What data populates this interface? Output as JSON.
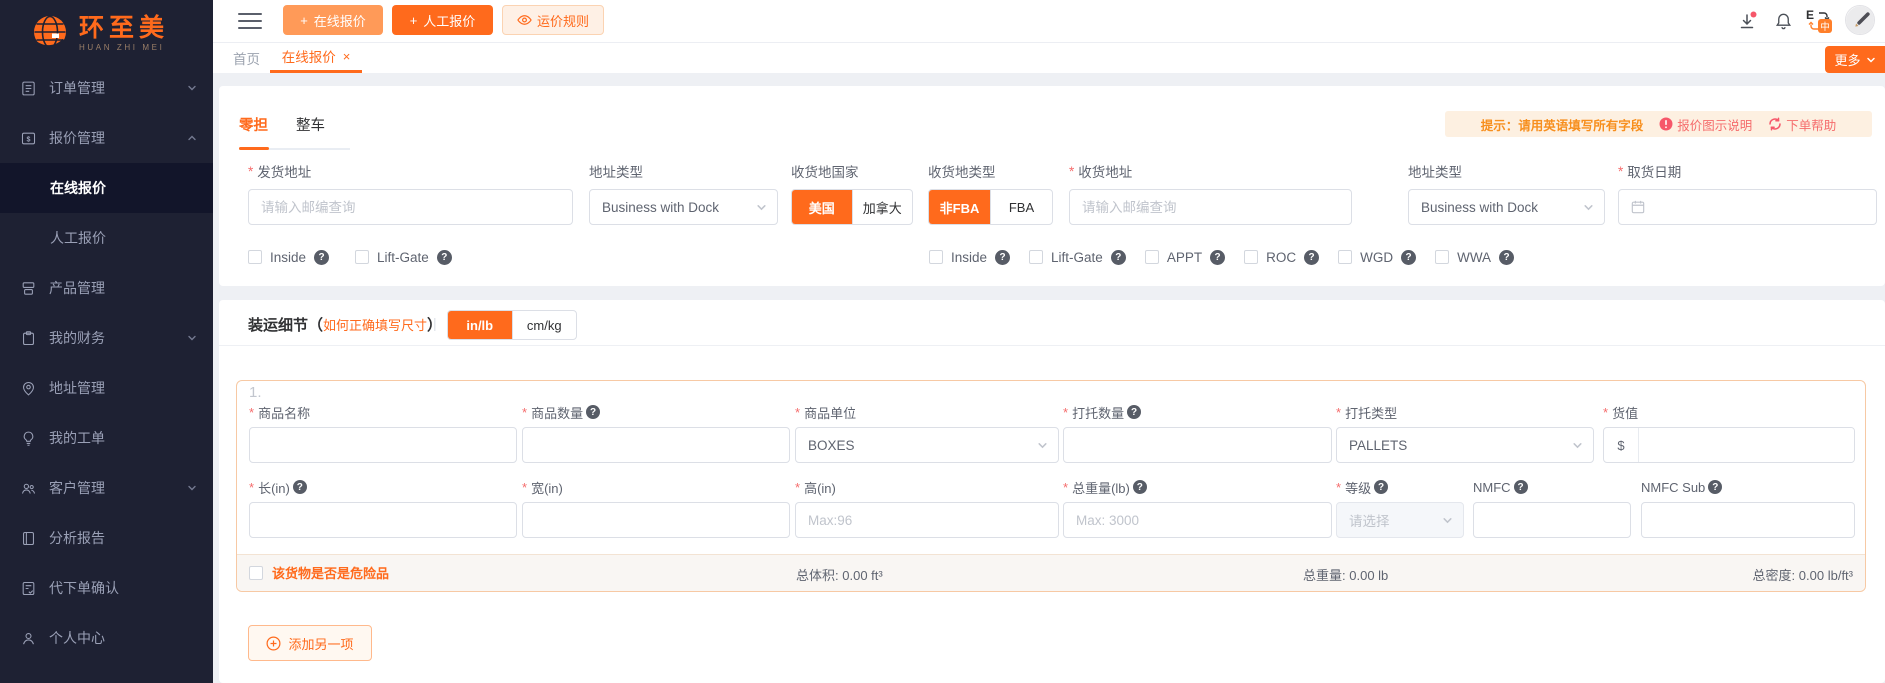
{
  "icons": {
    "plus": "+",
    "close": "×",
    "required": "*",
    "question": "?",
    "dollar": "$",
    "paren_open": "（",
    "paren_close": "）",
    "divider": "|",
    "index_1": "1."
  },
  "sidebar": {
    "logo_title": "环至美",
    "logo_subtitle": "HUAN ZHI MEI",
    "items": [
      {
        "label": "订单管理"
      },
      {
        "label": "报价管理"
      },
      {
        "label": "在线报价"
      },
      {
        "label": "人工报价"
      },
      {
        "label": "产品管理"
      },
      {
        "label": "我的财务"
      },
      {
        "label": "地址管理"
      },
      {
        "label": "我的工单"
      },
      {
        "label": "客户管理"
      },
      {
        "label": "分析报告"
      },
      {
        "label": "代下单确认"
      },
      {
        "label": "个人中心"
      }
    ]
  },
  "topbar": {
    "online_quote_button": "在线报价",
    "manual_quote_button": "人工报价",
    "rate_rules_button": "运价规则"
  },
  "tabbar": {
    "home_tab": "首页",
    "active_tab": "在线报价",
    "more_button": "更多"
  },
  "quote_form": {
    "mode_tab_ltl": "零担",
    "mode_tab_ftl": "整车",
    "hint_text": "提示：请用英语填写所有字段",
    "hint_link_quote_guide": "报价图示说明",
    "hint_link_order_help": "下单帮助",
    "pickup_address": {
      "label": "发货地址",
      "placeholder": "请输入邮编查询"
    },
    "pickup_address_type": {
      "label": "地址类型",
      "value": "Business with Dock"
    },
    "dest_country": {
      "label": "收货地国家",
      "option_us": "美国",
      "option_ca": "加拿大"
    },
    "dest_type": {
      "label": "收货地类型",
      "option_non_fba": "非FBA",
      "option_fba": "FBA"
    },
    "dest_address": {
      "label": "收货地址",
      "placeholder": "请输入邮编查询"
    },
    "dest_address_type": {
      "label": "地址类型",
      "value": "Business with Dock"
    },
    "pickup_date": {
      "label": "取货日期"
    },
    "pickup_options": [
      {
        "label": "Inside"
      },
      {
        "label": "Lift-Gate"
      }
    ],
    "dest_options": [
      {
        "label": "Inside"
      },
      {
        "label": "Lift-Gate"
      },
      {
        "label": "APPT"
      },
      {
        "label": "ROC"
      },
      {
        "label": "WGD"
      },
      {
        "label": "WWA"
      }
    ]
  },
  "shipment": {
    "title": "装运细节",
    "size_help_link": "如何正确填写尺寸",
    "unit_in_lb": "in/lb",
    "unit_cm_kg": "cm/kg",
    "item": {
      "name": {
        "label": "商品名称"
      },
      "qty": {
        "label": "商品数量"
      },
      "unit": {
        "label": "商品单位",
        "value": "BOXES"
      },
      "pallet_qty": {
        "label": "打托数量"
      },
      "pallet_type": {
        "label": "打托类型",
        "value": "PALLETS"
      },
      "value": {
        "label": "货值",
        "prefix": "$"
      },
      "length": {
        "label": "长(in)"
      },
      "width": {
        "label": "宽(in)"
      },
      "height": {
        "label": "高(in)",
        "placeholder": "Max:96"
      },
      "weight": {
        "label": "总重量(lb)",
        "placeholder": "Max: 3000"
      },
      "grade": {
        "label": "等级",
        "placeholder": "请选择"
      },
      "nmfc": {
        "label": "NMFC"
      },
      "nmfc_sub": {
        "label": "NMFC Sub"
      },
      "danger_label": "该货物是否是危险品",
      "volume_label": "总体积:",
      "volume_value": "0.00 ft³",
      "weight_label": "总重量:",
      "weight_value": "0.00 lb",
      "density_label": "总密度:",
      "density_value": "0.00 lb/ft³"
    },
    "add_item_button": "添加另一项"
  }
}
